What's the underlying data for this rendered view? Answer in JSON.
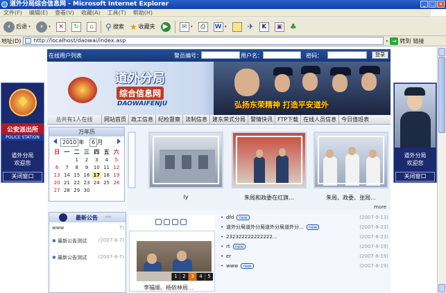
{
  "window": {
    "title": "道外分局综合信息网 - Microsoft Internet Explorer"
  },
  "menu": [
    "文件(F)",
    "编辑(E)",
    "查看(V)",
    "收藏(A)",
    "工具(T)",
    "帮助(H)"
  ],
  "toolbar": {
    "back_label": "后退",
    "search_label": "搜索",
    "favorites_label": "收藏夹"
  },
  "address": {
    "label": "地址(D)",
    "url": "http://localhost/daowai/index.asp",
    "go_label": "转到",
    "links_label": "链接"
  },
  "ads": {
    "left": {
      "title": "公安派出所",
      "subtitle": "POLICE STATION",
      "welcome": "道外分局\n欢迎您",
      "close_label": "关闭窗口"
    },
    "right": {
      "welcome": "道外分局\n欢迎您",
      "close_label": "关闭窗口"
    }
  },
  "login": {
    "online_label": "在线用户列表",
    "officer_label": "警员编号：",
    "user_label": "用户名：",
    "password_label": "密码：",
    "submit_label": "登录"
  },
  "banner": {
    "title": "道外分局",
    "subtitle": "综合信息网",
    "pinyin": "DAOWAIFENJU",
    "slogan": "弘扬东荣精神  打造平安道外"
  },
  "nav": {
    "online_count": "总共有1人在线",
    "items": [
      "网站首页",
      "政工信息",
      "纪检督察",
      "法制信息",
      "建东荣式分局",
      "警情快讯",
      "FTP下载",
      "在线人员信息",
      "今日值班表"
    ]
  },
  "calendar": {
    "title": "万年历",
    "year": "2010",
    "year_suffix": "年",
    "month": "6",
    "month_suffix": "月",
    "weekdays": [
      "日",
      "一",
      "二",
      "三",
      "四",
      "五",
      "六"
    ],
    "days": [
      "",
      "",
      "1",
      "2",
      "3",
      "4",
      "5",
      "6",
      "7",
      "8",
      "9",
      "10",
      "11",
      "12",
      "13",
      "14",
      "15",
      "16",
      "17",
      "18",
      "19",
      "20",
      "21",
      "22",
      "23",
      "24",
      "25",
      "26",
      "27",
      "28",
      "29",
      "30",
      "",
      "",
      ""
    ],
    "today": "17"
  },
  "photos": {
    "captions": [
      "ly",
      "朱局和政委在红旗...",
      "朱局、政委、张局..."
    ],
    "more_label": "more"
  },
  "news": {
    "title": "最新公告",
    "rows": [
      {
        "text": "www",
        "date": "7)"
      },
      {
        "text": "最新公告测试",
        "date": "(2007-8-7)"
      },
      {
        "text": "最新公告测试",
        "date": "(2007-8-7)"
      }
    ]
  },
  "image_panel": {
    "pages": [
      "1",
      "2",
      "3",
      "4",
      "5"
    ],
    "active_page": "3",
    "caption": "李福顺、杨侬林局..."
  },
  "articles": [
    {
      "title": "dfd",
      "date": "(2007-9-13)"
    },
    {
      "title": "道外分局道外分局道外分局道外分...",
      "date": "(2007-8-23)"
    },
    {
      "title": "232322222222222...",
      "date": "(2007-8-23)"
    },
    {
      "title": "rt",
      "date": "(2007-8-19)"
    },
    {
      "title": "er",
      "date": "(2007-8-19)"
    },
    {
      "title": "www",
      "date": "(2007-8-19)"
    }
  ],
  "new_badge": "new"
}
